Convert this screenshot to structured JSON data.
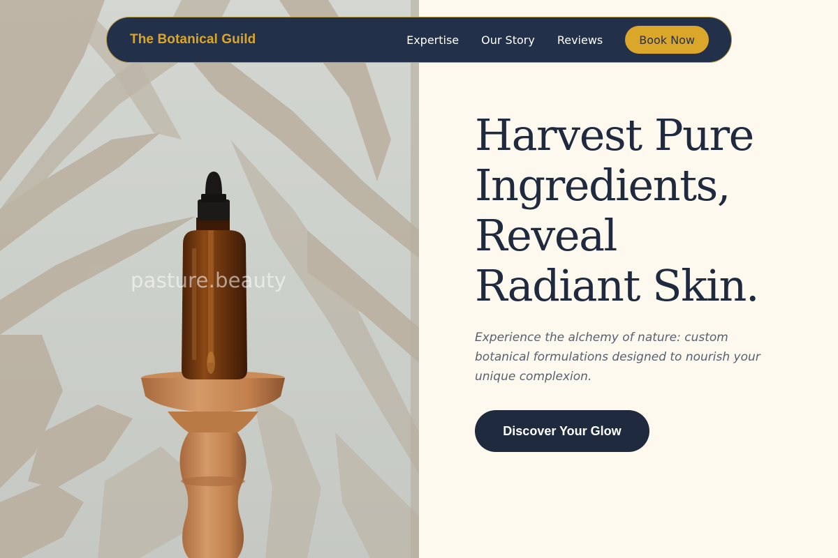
{
  "nav": {
    "brand": "The Botanical Guild",
    "links": [
      "Expertise",
      "Our Story",
      "Reviews"
    ],
    "book_label": "Book Now"
  },
  "hero": {
    "headline_lines": [
      "Harvest Pure",
      "Ingredients,",
      "Reveal",
      "Radiant Skin."
    ],
    "subtext": "Experience the alchemy of nature: custom botanical formulations designed to nourish your unique complexion.",
    "cta_label": "Discover Your Glow"
  },
  "image": {
    "watermark": "pasture.beauty"
  },
  "colors": {
    "navy": "#23304a",
    "gold": "#dba72a",
    "cream": "#fdf9ef",
    "text_muted": "#59606e"
  }
}
